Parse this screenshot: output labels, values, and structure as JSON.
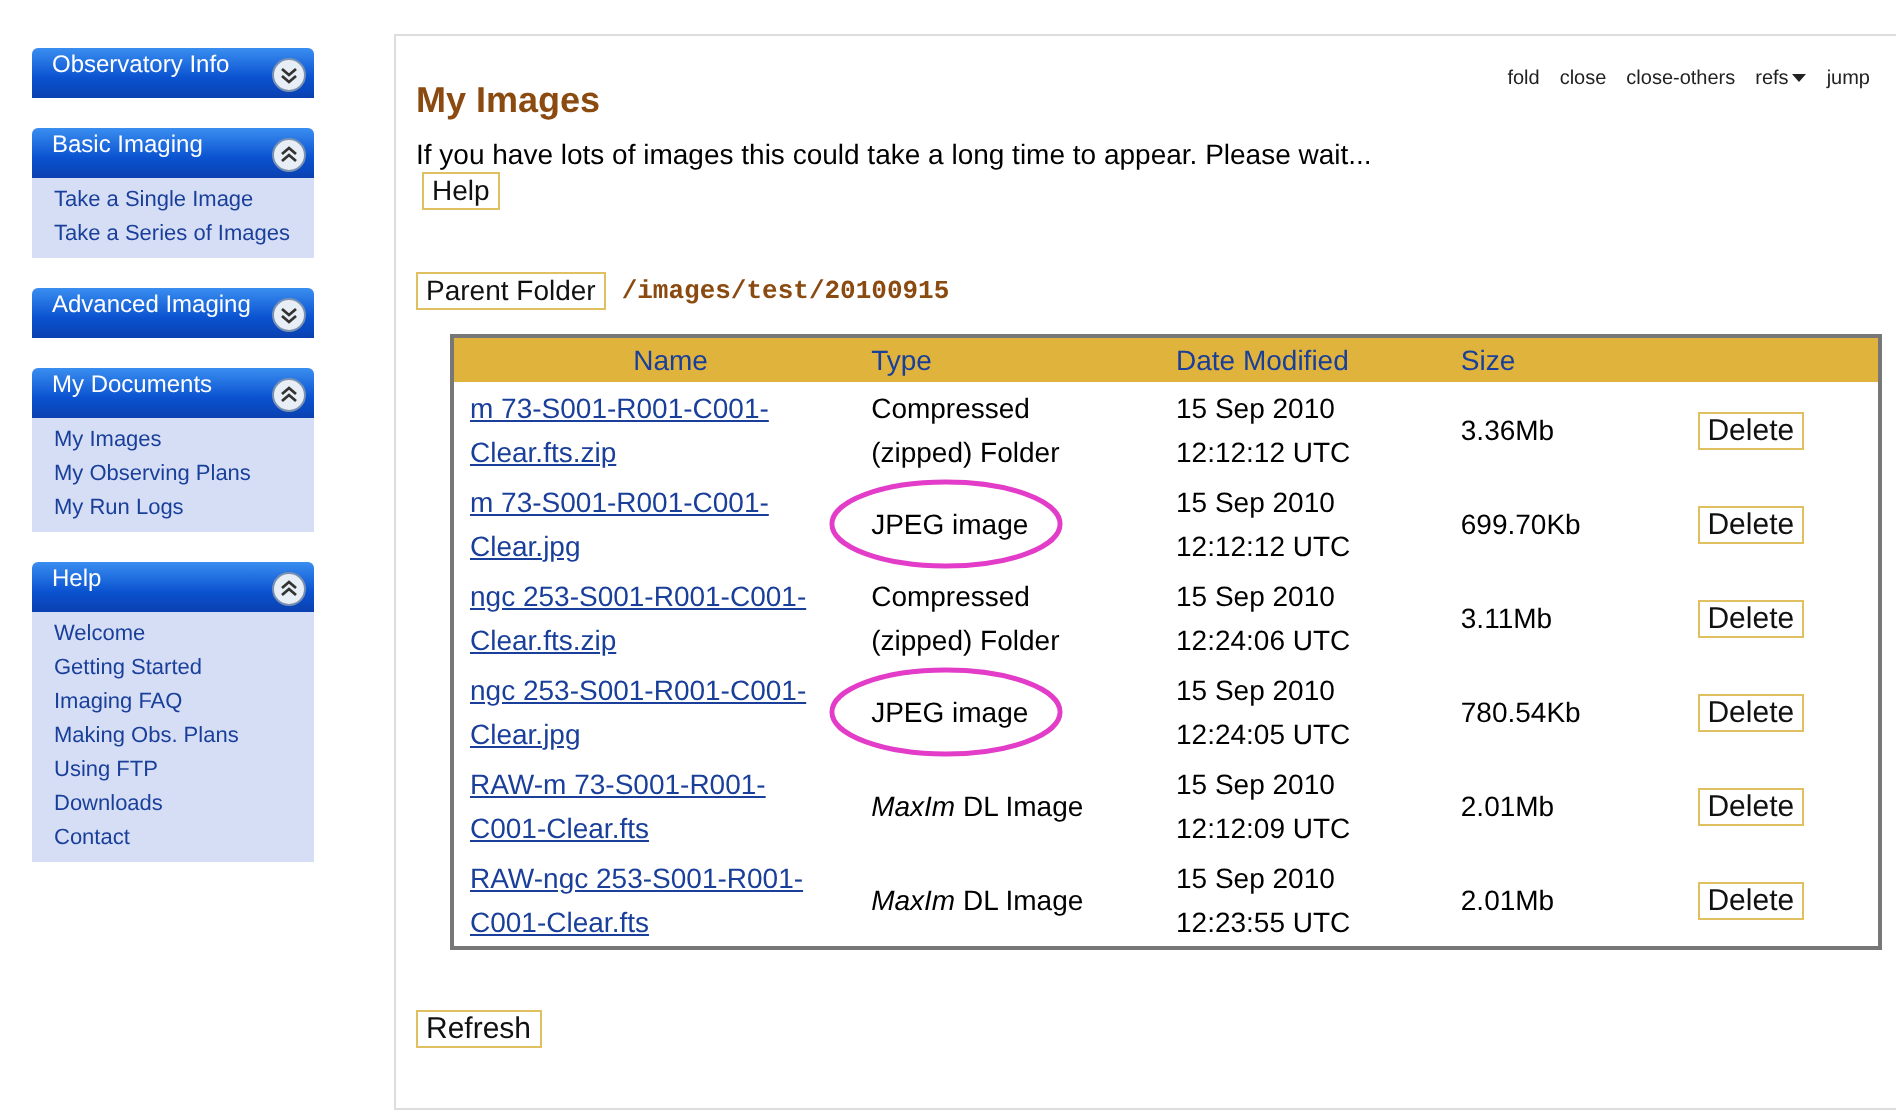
{
  "sidebar": {
    "sections": [
      {
        "title": "Observatory Info",
        "expanded": false
      },
      {
        "title": "Basic Imaging",
        "expanded": true,
        "items": [
          "Take a Single Image",
          "Take a Series of Images"
        ]
      },
      {
        "title": "Advanced Imaging",
        "expanded": false
      },
      {
        "title": "My Documents",
        "expanded": true,
        "items": [
          "My Images",
          "My Observing Plans",
          "My Run Logs"
        ]
      },
      {
        "title": "Help",
        "expanded": true,
        "items": [
          "Welcome",
          "Getting Started",
          "Imaging FAQ",
          "Making Obs. Plans",
          "Using FTP",
          "Downloads",
          "Contact"
        ]
      }
    ]
  },
  "panel": {
    "actions": [
      "fold",
      "close",
      "close-others",
      "refs",
      "jump"
    ],
    "title": "My Images",
    "notice": "If you have lots of images this could take a long time to appear. Please wait...",
    "help_button": "Help",
    "parent_button": "Parent Folder",
    "path": "/images/test/20100915",
    "table": {
      "columns": [
        "Name",
        "Type",
        "Date Modified",
        "Size"
      ],
      "rows": [
        {
          "name": "m 73-S001-R001-C001-Clear.fts.zip",
          "type": "Compressed (zipped) Folder",
          "date": "15 Sep 2010",
          "time": "12:12:12 UTC",
          "size": "3.36Mb",
          "action": "Delete",
          "circled": false
        },
        {
          "name": "m 73-S001-R001-C001-Clear.jpg",
          "type": "JPEG image",
          "date": "15 Sep 2010",
          "time": "12:12:12 UTC",
          "size": "699.70Kb",
          "action": "Delete",
          "circled": true
        },
        {
          "name": "ngc 253-S001-R001-C001-Clear.fts.zip",
          "type": "Compressed (zipped) Folder",
          "date": "15 Sep 2010",
          "time": "12:24:06 UTC",
          "size": "3.11Mb",
          "action": "Delete",
          "circled": false
        },
        {
          "name": "ngc 253-S001-R001-C001-Clear.jpg",
          "type": "JPEG image",
          "date": "15 Sep 2010",
          "time": "12:24:05 UTC",
          "size": "780.54Kb",
          "action": "Delete",
          "circled": true
        },
        {
          "name": "RAW-m 73-S001-R001-C001-Clear.fts",
          "type": "*MaxIm* DL Image",
          "date": "15 Sep 2010",
          "time": "12:12:09 UTC",
          "size": "2.01Mb",
          "action": "Delete",
          "circled": false
        },
        {
          "name": "RAW-ngc 253-S001-R001-C001-Clear.fts",
          "type": "*MaxIm* DL Image",
          "date": "15 Sep 2010",
          "time": "12:23:55 UTC",
          "size": "2.01Mb",
          "action": "Delete",
          "circled": false
        }
      ]
    },
    "refresh_button": "Refresh"
  }
}
